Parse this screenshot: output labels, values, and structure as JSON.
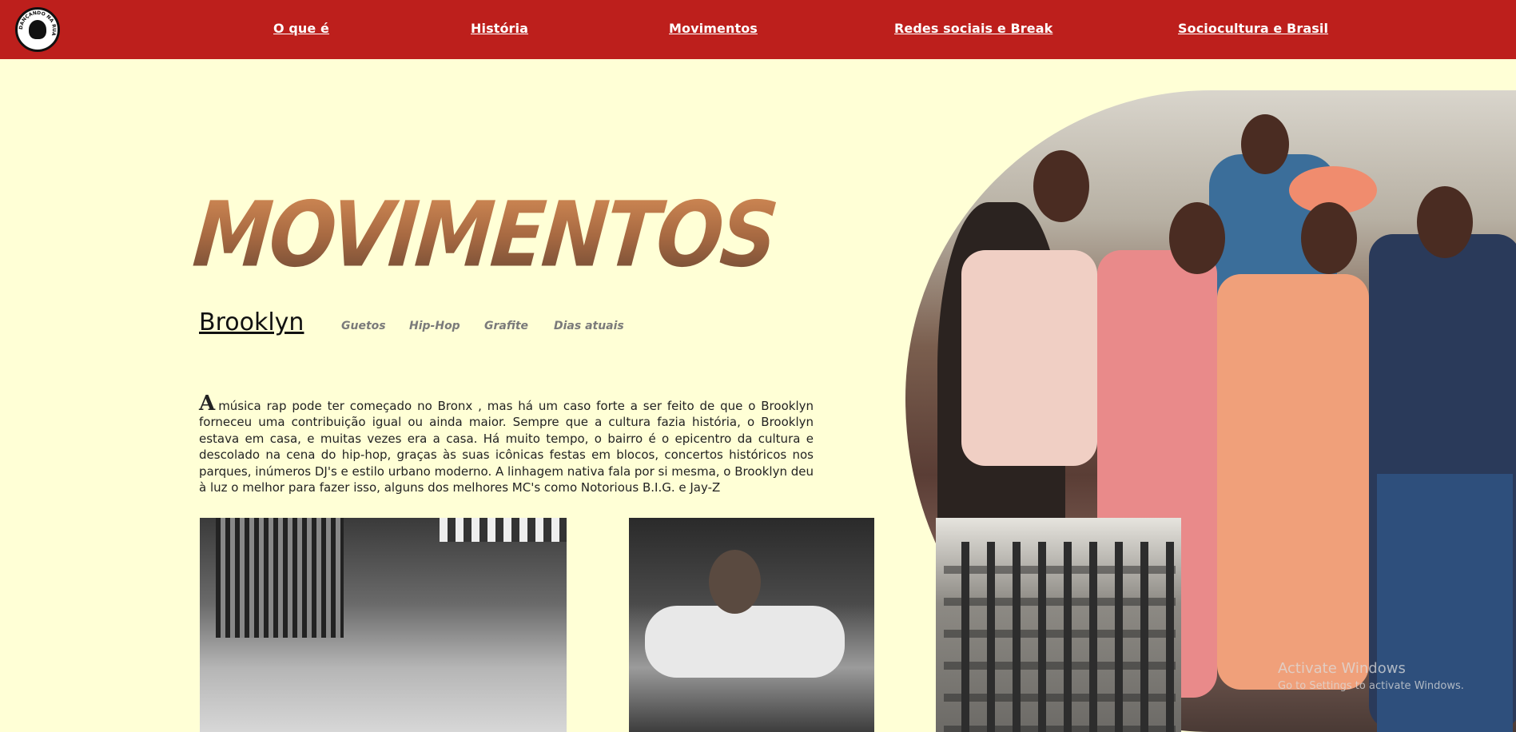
{
  "navbar": {
    "logo_text": "DANÇANDO NA RUA",
    "links": [
      "O que é",
      "História",
      "Movimentos",
      "Redes sociais e Break",
      "Sociocultura e Brasil"
    ],
    "background": "#bd1f1c"
  },
  "page": {
    "title": "MOVIMENTOS",
    "active_section": "Brooklyn",
    "sections": [
      "Guetos",
      "Hip-Hop",
      "Grafite",
      "Dias atuais"
    ],
    "paragraph_dropcap": "A",
    "paragraph": "música rap pode ter começado no Bronx , mas há um caso forte a ser feito de que o Brooklyn forneceu uma contribuição igual ou ainda maior. Sempre que a cultura fazia história, o Brooklyn estava em casa, e muitas vezes era a casa. Há muito tempo, o bairro é o epicentro da cultura e descolado na cena do hip-hop, graças às suas icônicas festas em blocos, concertos históricos nos parques, inúmeros DJ's e estilo urbano moderno. A linhagem nativa fala por si mesma, o Brooklyn deu à luz o melhor para fazer isso, alguns dos melhores MC's como Notorious B.I.G. e Jay-Z"
  },
  "watermark": {
    "title": "Activate Windows",
    "subtitle": "Go to Settings to activate Windows."
  }
}
